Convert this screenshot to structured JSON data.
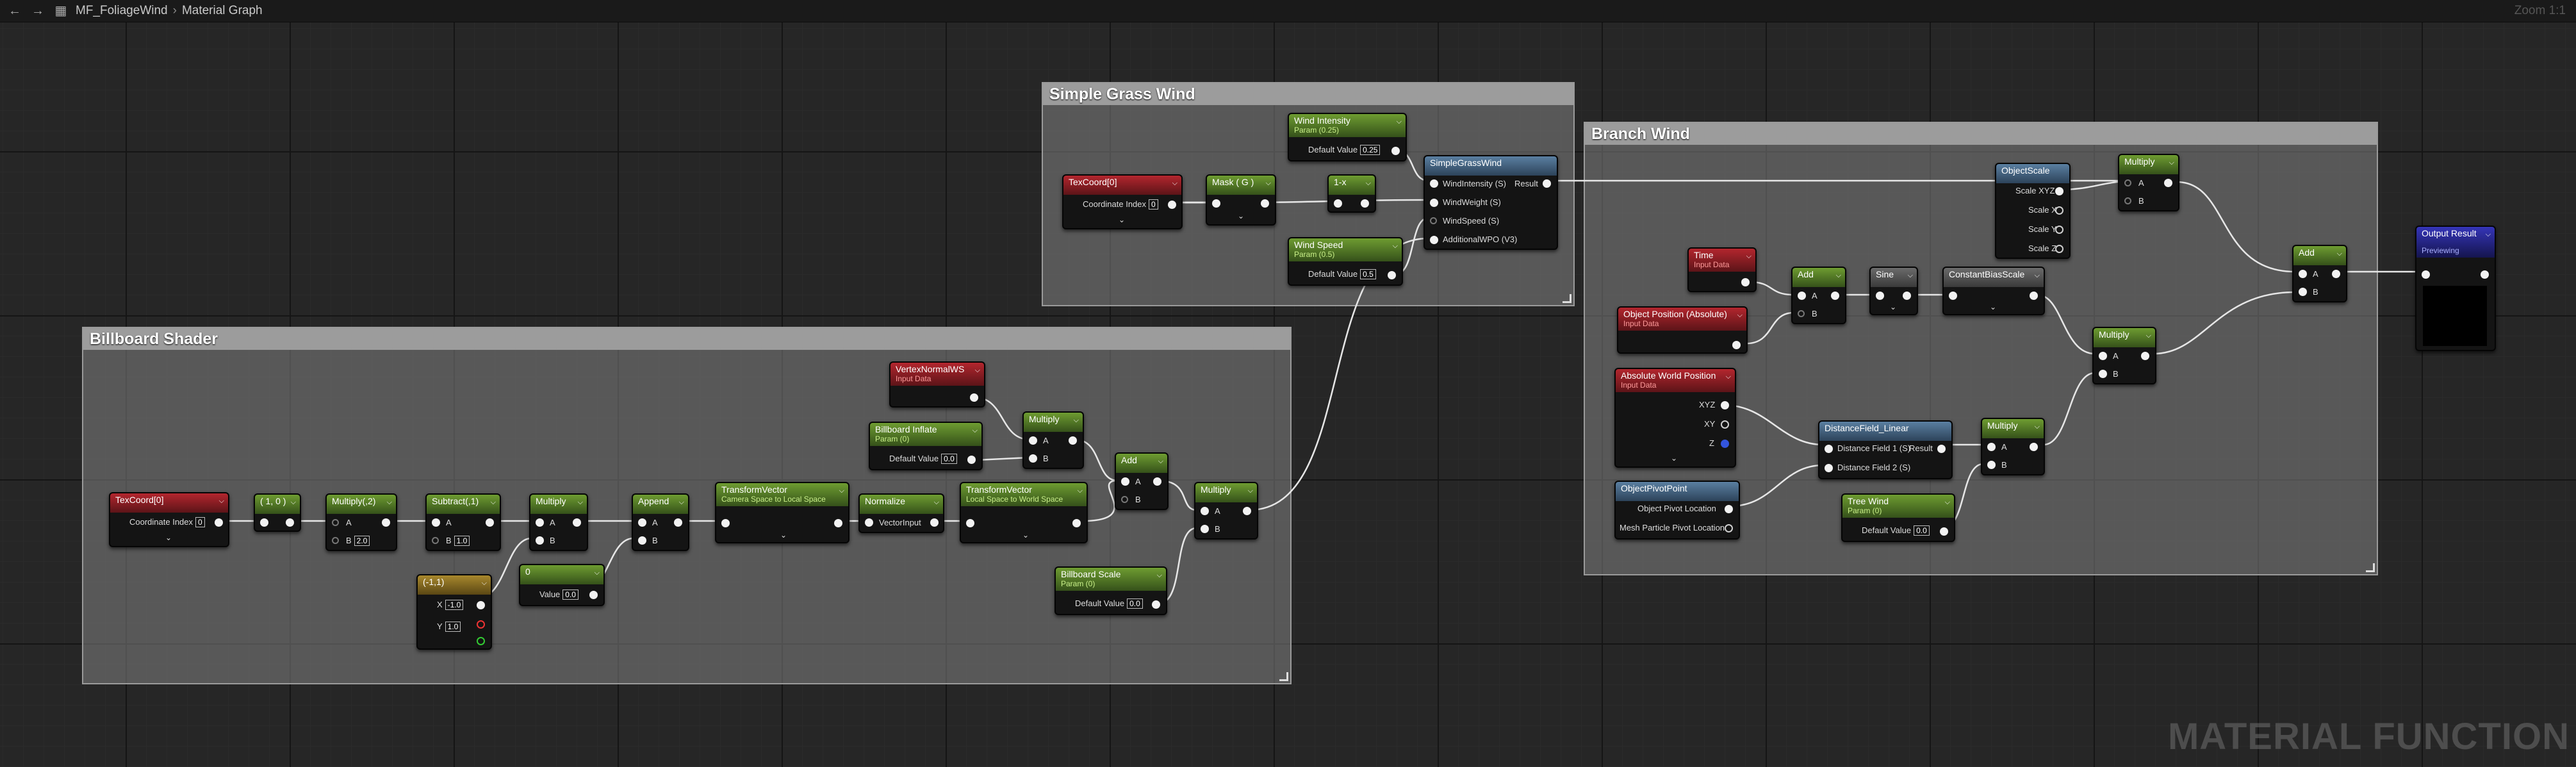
{
  "toolbar": {
    "asset_name": "MF_FoliageWind",
    "graph_name": "Material Graph",
    "zoom": "Zoom 1:1"
  },
  "comments": {
    "billboard": "Billboard Shader",
    "grass": "Simple Grass Wind",
    "branch": "Branch Wind"
  },
  "watermark": "MATERIAL FUNCTION",
  "nodes": {
    "bb_texcoord": {
      "title": "TexCoord[0]",
      "coord_label": "Coordinate Index",
      "coord_value": "0"
    },
    "bb_mask": {
      "title": "( 1, 0 )"
    },
    "bb_multiply": {
      "title": "Multiply(,2)",
      "a": "A",
      "b": "B",
      "b_value": "2.0"
    },
    "bb_subtract": {
      "title": "Subtract(,1)",
      "a": "A",
      "b": "B",
      "b_value": "1.0"
    },
    "bb_multiply2": {
      "title": "Multiply",
      "a": "A",
      "b": "B"
    },
    "bb_const2": {
      "title": "(-1,1)",
      "x_label": "X",
      "x_value": "-1.0",
      "y_label": "Y",
      "y_value": "1.0"
    },
    "bb_const0": {
      "title": "0",
      "value_label": "Value",
      "value": "0.0"
    },
    "bb_append": {
      "title": "Append",
      "a": "A",
      "b": "B"
    },
    "bb_transform1": {
      "title": "TransformVector",
      "subtitle": "Camera Space to Local Space"
    },
    "bb_normalize": {
      "title": "Normalize",
      "input": "VectorInput"
    },
    "bb_transform2": {
      "title": "TransformVector",
      "subtitle": "Local Space to World Space"
    },
    "bb_vertexnormal": {
      "title": "VertexNormalWS",
      "subtitle": "Input Data"
    },
    "bb_inflate": {
      "title": "Billboard Inflate",
      "subtitle": "Param (0)",
      "dv_label": "Default Value",
      "dv": "0.0"
    },
    "bb_multiply3": {
      "title": "Multiply",
      "a": "A",
      "b": "B"
    },
    "bb_add": {
      "title": "Add",
      "a": "A",
      "b": "B"
    },
    "bb_scale": {
      "title": "Billboard Scale",
      "subtitle": "Param (0)",
      "dv_label": "Default Value",
      "dv": "0.0"
    },
    "bb_multiply4": {
      "title": "Multiply",
      "a": "A",
      "b": "B"
    },
    "sg_texcoord": {
      "title": "TexCoord[0]",
      "coord_label": "Coordinate Index",
      "coord_value": "0"
    },
    "sg_mask": {
      "title": "Mask ( G )"
    },
    "sg_oneminus": {
      "title": "1-x"
    },
    "sg_intensity": {
      "title": "Wind Intensity",
      "subtitle": "Param (0.25)",
      "dv_label": "Default Value",
      "dv": "0.25"
    },
    "sg_speed": {
      "title": "Wind Speed",
      "subtitle": "Param (0.5)",
      "dv_label": "Default Value",
      "dv": "0.5"
    },
    "sg_func": {
      "title": "SimpleGrassWind",
      "pins": [
        "WindIntensity (S)",
        "WindWeight (S)",
        "WindSpeed (S)",
        "AdditionalWPO (V3)"
      ],
      "out": "Result"
    },
    "br_time": {
      "title": "Time",
      "subtitle": "Input Data"
    },
    "br_objpos": {
      "title": "Object Position (Absolute)",
      "subtitle": "Input Data"
    },
    "br_add": {
      "title": "Add",
      "a": "A",
      "b": "B"
    },
    "br_sine": {
      "title": "Sine"
    },
    "br_cbs": {
      "title": "ConstantBiasScale"
    },
    "br_objscale": {
      "title": "ObjectScale",
      "pins": [
        "Scale XYZ",
        "Scale X",
        "Scale Y",
        "Scale Z"
      ]
    },
    "br_multiply1": {
      "title": "Multiply",
      "a": "A",
      "b": "B"
    },
    "br_multiply2": {
      "title": "Multiply",
      "a": "A",
      "b": "B"
    },
    "br_awp": {
      "title": "Absolute World Position",
      "subtitle": "Input Data",
      "pins": [
        "XYZ",
        "XY",
        "Z"
      ]
    },
    "br_objpivot": {
      "title": "ObjectPivotPoint",
      "pins": [
        "Object Pivot Location",
        "Mesh Particle Pivot Location"
      ]
    },
    "br_distfield": {
      "title": "DistanceField_Linear",
      "pins": [
        "Distance Field 1 (S)",
        "Distance Field 2 (S)"
      ],
      "out": "Result"
    },
    "br_treewind": {
      "title": "Tree Wind",
      "subtitle": "Param (0)",
      "dv_label": "Default Value",
      "dv": "0.0"
    },
    "br_multiply3": {
      "title": "Multiply",
      "a": "A",
      "b": "B"
    },
    "br_add2": {
      "title": "Add",
      "a": "A",
      "b": "B"
    },
    "output": {
      "title": "Output Result",
      "subtitle": "Previewing"
    }
  }
}
